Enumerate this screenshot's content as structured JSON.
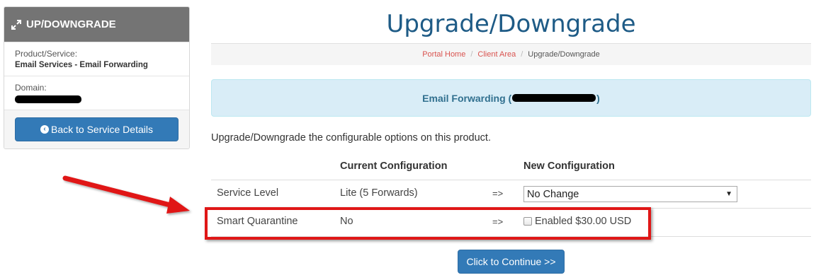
{
  "sidebar": {
    "header": "UP/DOWNGRADE",
    "product_label": "Product/Service:",
    "product_value": "Email Services - Email Forwarding",
    "domain_label": "Domain:",
    "back_button": "Back to Service Details"
  },
  "page": {
    "title": "Upgrade/Downgrade",
    "breadcrumb": [
      "Portal Home",
      "Client Area",
      "Upgrade/Downgrade"
    ],
    "info_box": {
      "product": "Email Forwarding (",
      "suffix": ")"
    },
    "description": "Upgrade/Downgrade the configurable options on this product."
  },
  "table": {
    "headers": {
      "current": "Current Configuration",
      "new": "New Configuration"
    },
    "rows": [
      {
        "option": "Service Level",
        "current": "Lite (5 Forwards)",
        "arrow": "=>",
        "new": "No Change"
      },
      {
        "option": "Smart Quarantine",
        "current": "No",
        "arrow": "=>",
        "new": "Enabled $30.00 USD"
      }
    ]
  },
  "continue_button": "Click to Continue >>",
  "colors": {
    "primary": "#337ab7",
    "title": "#1e5b86",
    "highlight": "#e01717",
    "info_bg": "#d9edf7"
  }
}
